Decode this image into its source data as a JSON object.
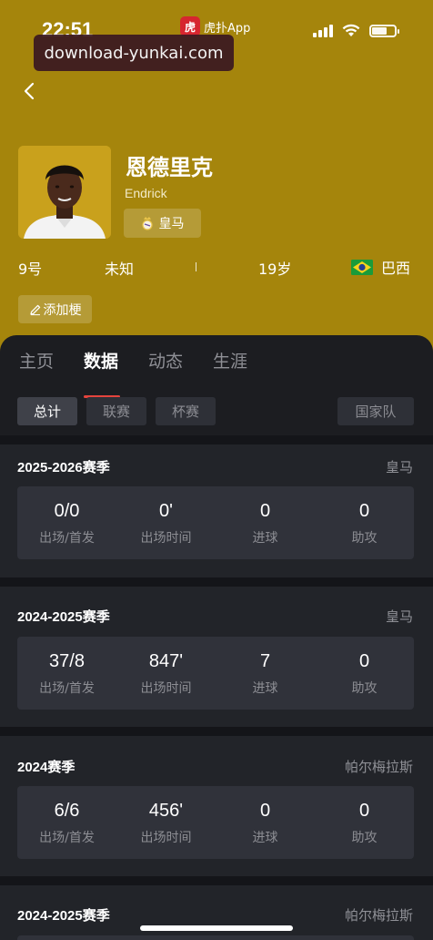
{
  "status_bar": {
    "time": "22:51",
    "app_name": "虎扑App",
    "app_logo_text": "虎"
  },
  "watermark": "download-yunkai.com",
  "player": {
    "name": "恩德里克",
    "en_name": "Endrick",
    "team": "皇马",
    "number": "9号",
    "position": "未知",
    "age": "19岁",
    "country": "巴西"
  },
  "edit_button": "添加梗",
  "tabs": [
    {
      "label": "主页",
      "active": false
    },
    {
      "label": "数据",
      "active": true
    },
    {
      "label": "动态",
      "active": false
    },
    {
      "label": "生涯",
      "active": false
    }
  ],
  "filters": [
    {
      "label": "总计",
      "active": true
    },
    {
      "label": "联赛",
      "active": false
    },
    {
      "label": "杯赛",
      "active": false
    },
    {
      "label": "国家队",
      "active": false
    }
  ],
  "stat_labels": [
    "出场/首发",
    "出场时间",
    "进球",
    "助攻"
  ],
  "seasons": [
    {
      "title": "2025-2026赛季",
      "team": "皇马",
      "values": [
        "0/0",
        "0'",
        "0",
        "0"
      ]
    },
    {
      "title": "2024-2025赛季",
      "team": "皇马",
      "values": [
        "37/8",
        "847'",
        "7",
        "0"
      ]
    },
    {
      "title": "2024赛季",
      "team": "帕尔梅拉斯",
      "values": [
        "6/6",
        "456'",
        "0",
        "0"
      ]
    },
    {
      "title": "2024-2025赛季",
      "team": "帕尔梅拉斯"
    }
  ],
  "colors": {
    "hero_bg": "#a5850c",
    "content_bg": "#1c1d21",
    "accent": "#e5443d"
  }
}
